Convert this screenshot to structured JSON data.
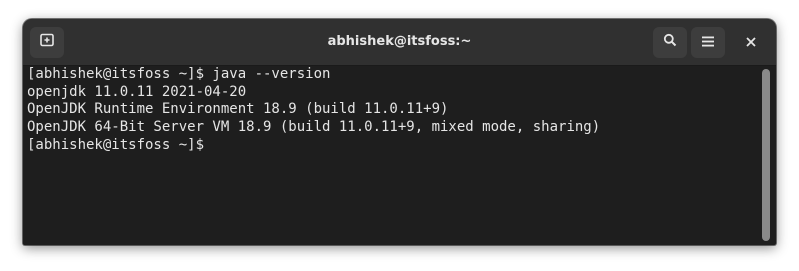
{
  "window": {
    "title": "abhishek@itsfoss:~"
  },
  "titlebar": {
    "buttons": [
      {
        "name": "new-tab",
        "icon": "new-tab-icon"
      },
      {
        "name": "search",
        "icon": "search-icon"
      },
      {
        "name": "menu",
        "icon": "hamburger-menu-icon"
      },
      {
        "name": "close",
        "icon": "close-icon"
      }
    ]
  },
  "terminal": {
    "lines": [
      "[abhishek@itsfoss ~]$ java --version",
      "openjdk 11.0.11 2021-04-20",
      "OpenJDK Runtime Environment 18.9 (build 11.0.11+9)",
      "OpenJDK 64-Bit Server VM 18.9 (build 11.0.11+9, mixed mode, sharing)",
      "[abhishek@itsfoss ~]$"
    ]
  },
  "colors": {
    "background": "#1e1e1e",
    "titlebar": "#303030",
    "text": "#e5e5e5",
    "button": "#3d3d3d",
    "scrollbar": "#8a8a8a"
  }
}
